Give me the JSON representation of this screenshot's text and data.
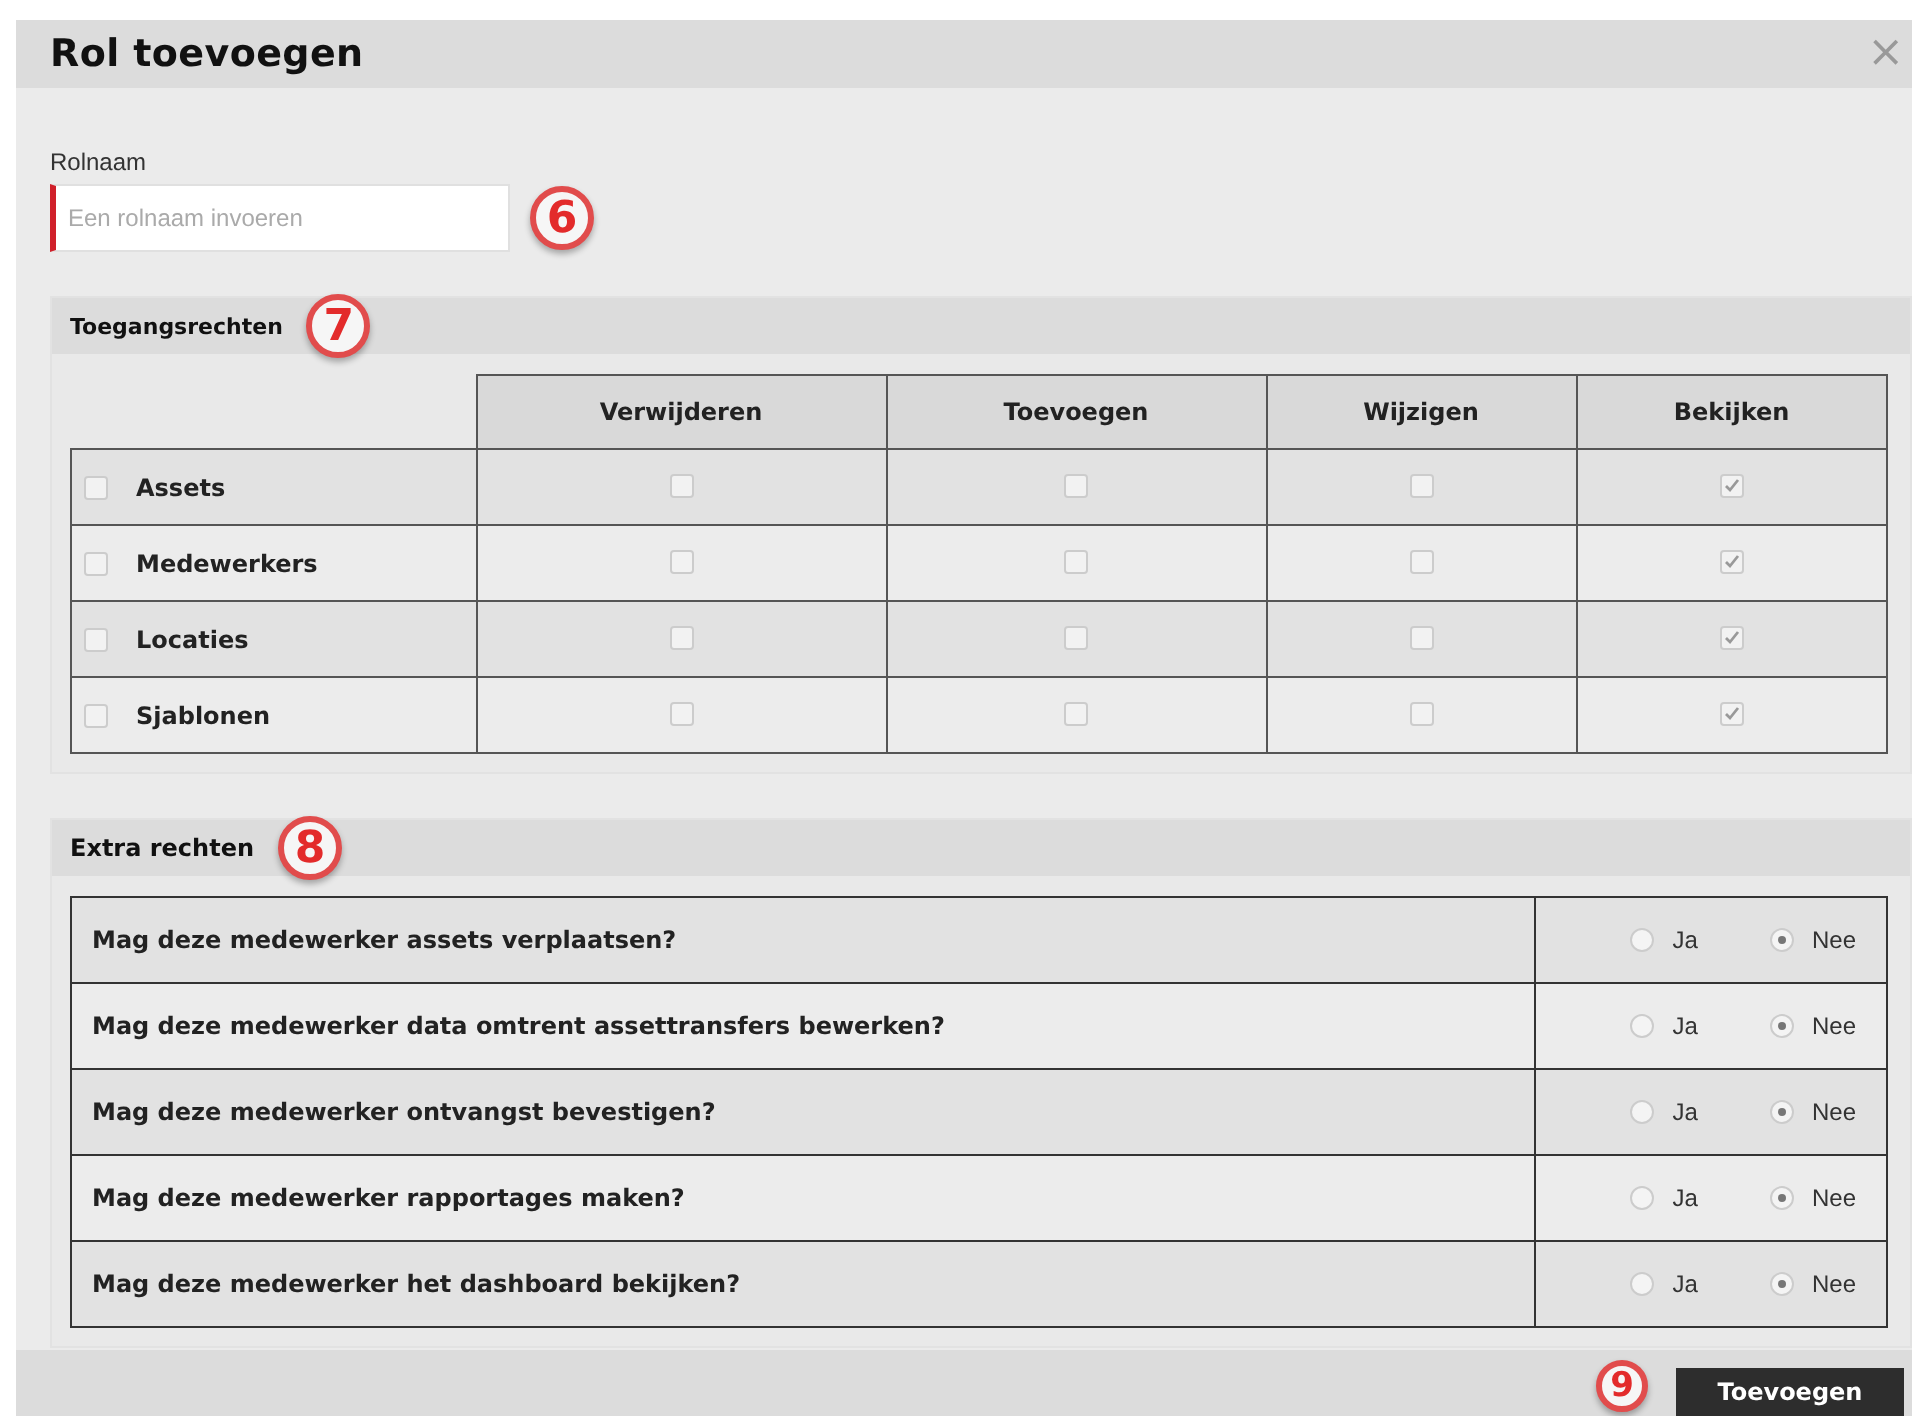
{
  "dialog": {
    "title": "Rol toevoegen",
    "close": "×"
  },
  "role_name": {
    "label": "Rolnaam",
    "placeholder": "Een rolnaam invoeren",
    "callout": "6"
  },
  "access": {
    "title": "Toegangsrechten",
    "callout": "7",
    "columns": [
      "Verwijderen",
      "Toevoegen",
      "Wijzigen",
      "Bekijken"
    ],
    "rows": [
      {
        "name": "Assets",
        "checked": false,
        "permissions": [
          false,
          false,
          false,
          true
        ]
      },
      {
        "name": "Medewerkers",
        "checked": false,
        "permissions": [
          false,
          false,
          false,
          true
        ]
      },
      {
        "name": "Locaties",
        "checked": false,
        "permissions": [
          false,
          false,
          false,
          true
        ]
      },
      {
        "name": "Sjablonen",
        "checked": false,
        "permissions": [
          false,
          false,
          false,
          true
        ]
      }
    ]
  },
  "extra": {
    "title": "Extra rechten",
    "callout": "8",
    "questions": [
      {
        "text": "Mag deze medewerker assets verplaatsen?",
        "options": [
          {
            "label": "Ja",
            "selected": false
          },
          {
            "label": "Nee",
            "selected": true
          }
        ]
      },
      {
        "text": "Mag deze medewerker data omtrent assettransfers bewerken?",
        "options": [
          {
            "label": "Ja",
            "selected": false
          },
          {
            "label": "Nee",
            "selected": true
          }
        ]
      },
      {
        "text": "Mag deze medewerker ontvangst bevestigen?",
        "options": [
          {
            "label": "Ja",
            "selected": false
          },
          {
            "label": "Nee",
            "selected": true
          }
        ]
      },
      {
        "text": "Mag deze medewerker rapportages maken?",
        "options": [
          {
            "label": "Ja",
            "selected": false
          },
          {
            "label": "Nee",
            "selected": true
          }
        ]
      },
      {
        "text": "Mag deze medewerker het dashboard bekijken?",
        "options": [
          {
            "label": "Ja",
            "selected": false
          },
          {
            "label": "Nee",
            "selected": true
          }
        ]
      }
    ]
  },
  "footer": {
    "callout": "9",
    "button": "Toevoegen"
  }
}
